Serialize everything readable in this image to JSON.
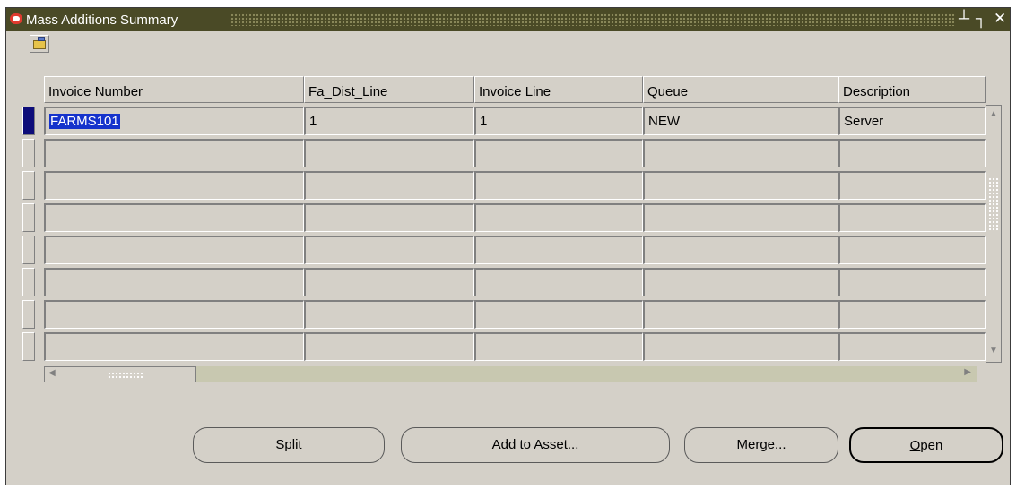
{
  "window": {
    "title": "Mass Additions Summary"
  },
  "title_controls": {
    "minimize": "┴",
    "restore": "┐",
    "close": "✕"
  },
  "toolbar": {
    "icon": "folder-open-icon"
  },
  "columns": [
    "Invoice Number",
    "Fa_Dist_Line",
    "Invoice Line",
    "Queue",
    "Description"
  ],
  "rows": [
    [
      "FARMS101",
      "1",
      "1",
      "NEW",
      "Server"
    ],
    [
      "",
      "",
      "",
      "",
      ""
    ],
    [
      "",
      "",
      "",
      "",
      ""
    ],
    [
      "",
      "",
      "",
      "",
      ""
    ],
    [
      "",
      "",
      "",
      "",
      ""
    ],
    [
      "",
      "",
      "",
      "",
      ""
    ],
    [
      "",
      "",
      "",
      "",
      ""
    ],
    [
      "",
      "",
      "",
      "",
      ""
    ]
  ],
  "selected_row": 0,
  "buttons": [
    {
      "mnemonic": "S",
      "rest": "plit"
    },
    {
      "mnemonic": "A",
      "rest": "dd to Asset..."
    },
    {
      "mnemonic": "M",
      "rest": "erge..."
    },
    {
      "mnemonic": "O",
      "rest": "pen"
    }
  ],
  "colors": {
    "titlebar": "#4a4a26",
    "selection": "#1533cc",
    "current_row_marker": "#0d0d7a",
    "panel": "#d4d0c8"
  }
}
